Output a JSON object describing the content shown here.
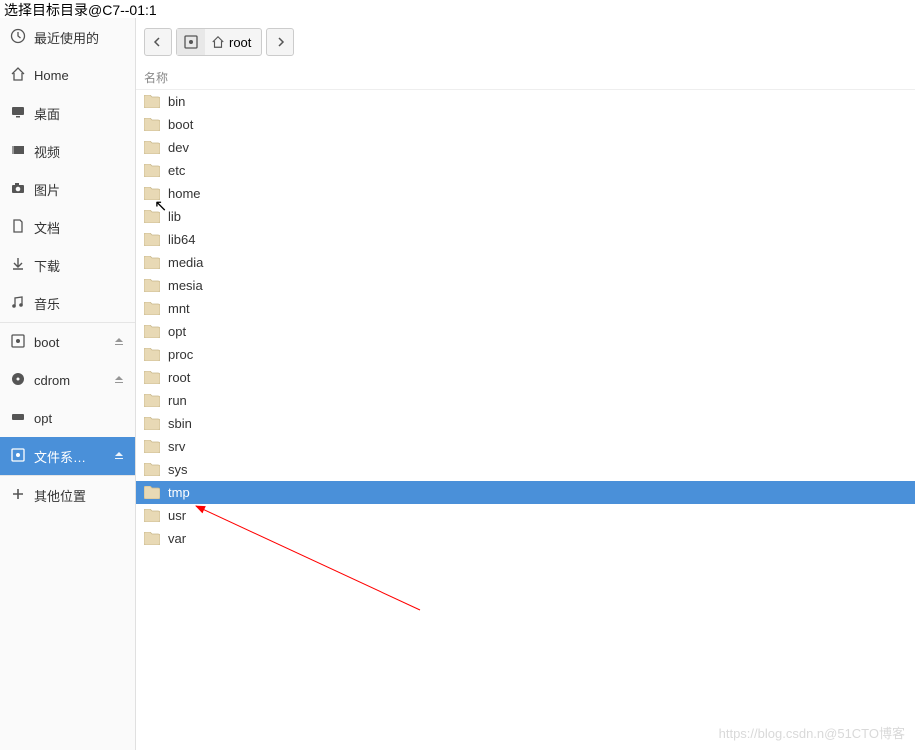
{
  "title_truncated": "选择目标目录@C7--01:1",
  "sidebar": {
    "recent": "最近使用的",
    "home": "Home",
    "desktop": "桌面",
    "video": "视频",
    "pictures": "图片",
    "documents": "文档",
    "downloads": "下载",
    "music": "音乐",
    "devices": {
      "boot": "boot",
      "cdrom": "cdrom",
      "opt": "opt",
      "filesystem": "文件系…"
    },
    "other": "其他位置"
  },
  "toolbar": {
    "root_label": "root"
  },
  "column_header": "名称",
  "folders": [
    "bin",
    "boot",
    "dev",
    "etc",
    "home",
    "lib",
    "lib64",
    "media",
    "mesia",
    "mnt",
    "opt",
    "proc",
    "root",
    "run",
    "sbin",
    "srv",
    "sys",
    "tmp",
    "usr",
    "var"
  ],
  "selected_folder": "tmp",
  "watermark": "https://blog.csdn.n@51CTO博客"
}
